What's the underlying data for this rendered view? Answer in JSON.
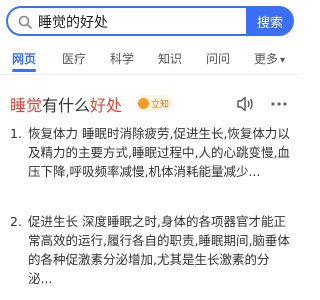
{
  "search": {
    "query": "睡觉的好处",
    "button_label": "搜索"
  },
  "tabs": [
    {
      "label": "网页",
      "active": true
    },
    {
      "label": "医疗",
      "active": false
    },
    {
      "label": "科学",
      "active": false
    },
    {
      "label": "知识",
      "active": false
    },
    {
      "label": "问问",
      "active": false
    },
    {
      "label": "更多",
      "active": false
    }
  ],
  "result": {
    "title_part1": "睡觉",
    "title_part2": "有什么",
    "title_part3": "好处",
    "badge": "立知",
    "items": [
      {
        "num": "1.",
        "text": "恢复体力 睡眠时消除疲劳,促进生长,恢复体力以及精力的主要方式,睡眠过程中,人的心跳变慢,血压下降,呼吸频率减慢,机体消耗能量减少..."
      },
      {
        "num": "2.",
        "text": "促进生长 深度睡眠之时,身体的各项器官才能正常高效的运行,履行各自的职责,睡眠期间,脑垂体的各种促激素分泌增加,尤其是生长激素的分泌..."
      }
    ]
  },
  "colors": {
    "accent": "#3b6ff6",
    "highlight": "#e0443a",
    "badge": "#f59a23"
  },
  "icons": [
    "search-icon",
    "speaker-icon",
    "more-dots-icon",
    "chevron-down-icon"
  ]
}
